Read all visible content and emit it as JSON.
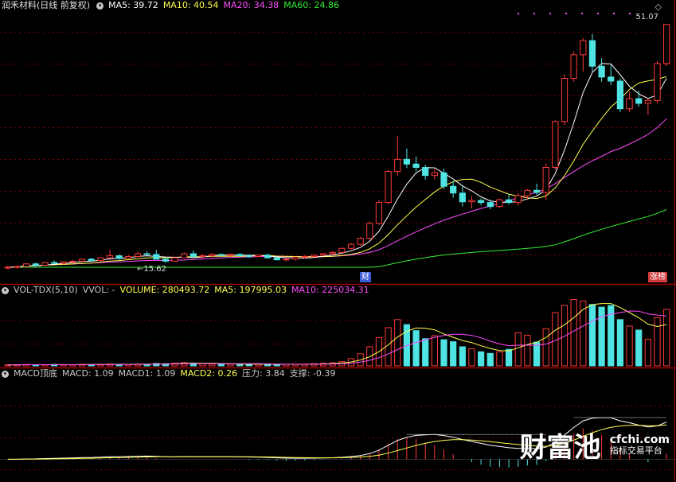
{
  "header_price": {
    "stock": "润禾材料(日线 前复权)",
    "ma5": "MA5: 39.72",
    "ma10": "MA10: 40.54",
    "ma20": "MA20: 34.38",
    "ma60": "MA60: 24.86"
  },
  "header_vol": {
    "name": "VOL-TDX(5,10)",
    "vvol": "VVOL: -",
    "volume": "VOLUME: 280493.72",
    "ma5": "MA5: 197995.03",
    "ma10": "MA10: 225034.31"
  },
  "header_macd": {
    "name": "MACD顶底",
    "macd": "MACD: 1.09",
    "macd1": "MACD1: 1.09",
    "macd2": "MACD2: 0.26",
    "pressure": "压力: 3.84",
    "support": "支撑: -0.39"
  },
  "annotations": {
    "high_label": "51.07",
    "low_label": "←15.62",
    "cai_tag": "财",
    "zhangting_tag": "涨榜"
  },
  "watermark": {
    "brand": "财富池",
    "domain": "cfchi.com",
    "slogan": "指标交易平台"
  },
  "colors": {
    "background": "#000000",
    "up": "#ff3a3a",
    "down": "#4fe3e3",
    "ma5": "#ffffff",
    "ma10": "#ffff4d",
    "ma20": "#ff4dff",
    "ma60": "#33ee33",
    "grid": "#7a0000",
    "divider": "#9a0000",
    "label_blue": "#3a5bd9"
  },
  "chart_data": {
    "type": "candlestick",
    "candles": [
      [
        14.9,
        15.2,
        14.7,
        15.0
      ],
      [
        15.0,
        15.3,
        14.8,
        15.1
      ],
      [
        15.1,
        15.6,
        15.0,
        15.5
      ],
      [
        15.5,
        15.7,
        15.2,
        15.3
      ],
      [
        15.3,
        15.8,
        15.2,
        15.7
      ],
      [
        15.7,
        16.0,
        15.5,
        15.6
      ],
      [
        15.6,
        15.9,
        15.4,
        15.8
      ],
      [
        15.8,
        16.1,
        15.6,
        15.9
      ],
      [
        15.9,
        16.3,
        15.8,
        16.2
      ],
      [
        16.2,
        16.4,
        15.9,
        16.0
      ],
      [
        16.0,
        16.5,
        15.9,
        16.4
      ],
      [
        16.4,
        17.6,
        16.3,
        16.7
      ],
      [
        16.7,
        16.9,
        16.1,
        16.3
      ],
      [
        16.3,
        16.8,
        16.2,
        16.6
      ],
      [
        16.6,
        17.3,
        16.5,
        17.0
      ],
      [
        17.0,
        17.4,
        16.8,
        16.9
      ],
      [
        16.9,
        17.6,
        16.6,
        16.2
      ],
      [
        16.2,
        16.3,
        15.62,
        15.9
      ],
      [
        15.9,
        16.6,
        15.8,
        16.4
      ],
      [
        16.4,
        17.2,
        16.3,
        17.0
      ],
      [
        17.0,
        17.5,
        16.8,
        16.6
      ],
      [
        16.6,
        16.9,
        16.4,
        16.7
      ],
      [
        16.7,
        17.1,
        16.5,
        16.9
      ],
      [
        16.9,
        17.0,
        16.6,
        16.8
      ],
      [
        16.8,
        17.0,
        16.5,
        16.9
      ],
      [
        16.9,
        17.1,
        16.6,
        16.7
      ],
      [
        16.7,
        16.9,
        16.4,
        16.6
      ],
      [
        16.6,
        16.9,
        16.5,
        16.8
      ],
      [
        16.8,
        17.0,
        16.3,
        16.4
      ],
      [
        16.4,
        16.6,
        16.0,
        16.1
      ],
      [
        16.1,
        16.4,
        15.9,
        16.2
      ],
      [
        16.2,
        16.6,
        16.0,
        16.5
      ],
      [
        16.5,
        16.8,
        16.3,
        16.6
      ],
      [
        16.6,
        16.9,
        16.4,
        16.8
      ],
      [
        16.8,
        17.1,
        16.6,
        17.0
      ],
      [
        17.0,
        17.4,
        16.8,
        17.2
      ],
      [
        17.2,
        17.9,
        17.0,
        17.8
      ],
      [
        17.8,
        18.6,
        17.6,
        18.4
      ],
      [
        18.4,
        19.5,
        18.2,
        19.3
      ],
      [
        19.3,
        21.8,
        19.1,
        21.5
      ],
      [
        21.5,
        25.0,
        21.3,
        24.6
      ],
      [
        24.6,
        29.5,
        24.4,
        29.2
      ],
      [
        29.2,
        34.5,
        28.6,
        31.0
      ],
      [
        31.0,
        32.6,
        29.7,
        30.3
      ],
      [
        30.3,
        31.4,
        29.2,
        29.8
      ],
      [
        29.8,
        30.2,
        28.0,
        28.6
      ],
      [
        28.6,
        29.6,
        28.0,
        29.0
      ],
      [
        29.0,
        29.6,
        26.6,
        27.0
      ],
      [
        27.0,
        27.8,
        25.3,
        26.0
      ],
      [
        26.0,
        27.0,
        24.0,
        24.7
      ],
      [
        24.7,
        25.6,
        23.7,
        24.9
      ],
      [
        24.9,
        25.2,
        24.2,
        24.6
      ],
      [
        24.6,
        25.0,
        23.6,
        24.0
      ],
      [
        24.0,
        25.2,
        23.8,
        25.0
      ],
      [
        25.0,
        25.8,
        24.3,
        24.6
      ],
      [
        24.6,
        26.0,
        24.2,
        25.6
      ],
      [
        25.6,
        26.6,
        25.1,
        26.4
      ],
      [
        26.4,
        27.4,
        25.7,
        26.1
      ],
      [
        26.1,
        30.4,
        25.0,
        29.8
      ],
      [
        29.8,
        36.8,
        29.4,
        36.6
      ],
      [
        36.6,
        43.6,
        36.1,
        43.0
      ],
      [
        43.0,
        47.0,
        42.5,
        46.5
      ],
      [
        46.5,
        49.0,
        44.0,
        48.6
      ],
      [
        48.6,
        49.6,
        44.0,
        44.8
      ],
      [
        44.8,
        46.0,
        42.5,
        43.2
      ],
      [
        43.2,
        45.0,
        42.0,
        42.6
      ],
      [
        42.6,
        43.0,
        38.0,
        38.5
      ],
      [
        38.5,
        41.0,
        38.0,
        40.0
      ],
      [
        40.0,
        41.2,
        38.8,
        39.3
      ],
      [
        39.3,
        40.0,
        37.6,
        39.72
      ],
      [
        39.72,
        45.6,
        39.3,
        45.2
      ],
      [
        45.2,
        51.07,
        44.8,
        51.0
      ]
    ],
    "volume": [
      5000,
      6000,
      7000,
      5500,
      6200,
      7000,
      6000,
      5600,
      7200,
      6500,
      8000,
      9500,
      8000,
      7500,
      9000,
      8500,
      12000,
      11000,
      13000,
      16000,
      14000,
      11000,
      9000,
      8500,
      8800,
      8600,
      8000,
      8200,
      7600,
      7200,
      7800,
      8400,
      9000,
      11000,
      13000,
      15000,
      21000,
      36000,
      60000,
      95000,
      140000,
      190000,
      230000,
      205000,
      175000,
      135000,
      150000,
      130000,
      120000,
      95000,
      85000,
      70000,
      62000,
      70000,
      82000,
      165000,
      152000,
      118000,
      185000,
      265000,
      300000,
      330000,
      322000,
      305000,
      292000,
      300000,
      230000,
      198000,
      178000,
      132000,
      240000,
      280493.72
    ],
    "volume_ma5_last": 197995.03,
    "volume_ma10_last": 225034.31,
    "ma_last": {
      "ma5": 39.72,
      "ma10": 40.54,
      "ma20": 34.38,
      "ma60": 24.86
    },
    "price_high": 51.07,
    "price_low": 15.62,
    "macd_last": {
      "macd": 1.09,
      "macd1": 1.09,
      "macd2": 0.26,
      "pressure": 3.84,
      "support": -0.39
    }
  }
}
